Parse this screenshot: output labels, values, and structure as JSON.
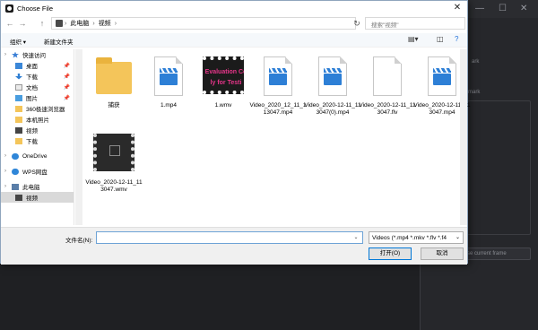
{
  "dialog": {
    "title": "Choose File",
    "close": "✕"
  },
  "address": {
    "back": "←",
    "forward": "→",
    "up": "↑",
    "path": [
      "此电脑",
      "视频"
    ],
    "refresh": "↻",
    "search_placeholder": "搜索\"视频\""
  },
  "toolbar": {
    "organize": "组织 ▾",
    "new_folder": "新建文件夹"
  },
  "sidebar": {
    "items": [
      {
        "label": "快速访问",
        "icon": "star-icon",
        "pinned": false,
        "group": true
      },
      {
        "label": "桌面",
        "icon": "desktop-icon",
        "pinned": true
      },
      {
        "label": "下载",
        "icon": "download-icon",
        "pinned": true
      },
      {
        "label": "文档",
        "icon": "document-icon",
        "pinned": true
      },
      {
        "label": "图片",
        "icon": "picture-icon",
        "pinned": true
      },
      {
        "label": "360极速浏览器",
        "icon": "folder-icon",
        "pinned": false
      },
      {
        "label": "本机照片",
        "icon": "folder-icon",
        "pinned": false
      },
      {
        "label": "视频",
        "icon": "video-icon",
        "pinned": false
      },
      {
        "label": "下载",
        "icon": "folder-icon",
        "pinned": false
      },
      {
        "label": "OneDrive",
        "icon": "cloud-icon",
        "pinned": false,
        "group": true
      },
      {
        "label": "WPS网盘",
        "icon": "cloud-icon",
        "pinned": false,
        "group": true
      },
      {
        "label": "此电脑",
        "icon": "computer-icon",
        "pinned": false,
        "group": true
      },
      {
        "label": "视频",
        "icon": "video-icon",
        "pinned": false,
        "selected": true
      }
    ]
  },
  "files": [
    {
      "name": "捕获",
      "kind": "folder"
    },
    {
      "name": "1.mp4",
      "kind": "video"
    },
    {
      "name": "1.wmv",
      "kind": "wmv",
      "thumb_text": "Evaluation Co\nly for Testi"
    },
    {
      "name": "Video_2020_12_11_113047.mp4",
      "kind": "video"
    },
    {
      "name": "Video_2020-12-11_113047(0).mp4",
      "kind": "video"
    },
    {
      "name": "Video_2020-12-11_113047.flv",
      "kind": "blank"
    },
    {
      "name": "Video_2020-12-11_113047.mp4",
      "kind": "video"
    },
    {
      "name": "Video_2020-12-11_113047.wmv",
      "kind": "dark"
    }
  ],
  "bottom": {
    "filename_label": "文件名(N):",
    "filename_value": "",
    "filetype": "Videos (*.mp4 *.mkv *.flv *.f4",
    "open": "打开(O)",
    "cancel": "取消"
  },
  "background": {
    "panel_text_1": "ark",
    "panel_text_2": "mark",
    "input_placeholder": "se current frame",
    "min": "—",
    "max": "☐",
    "close": "✕"
  },
  "colors": {
    "accent": "#0078d7",
    "folder": "#f4c55a",
    "video_icon": "#2d7fd6"
  }
}
